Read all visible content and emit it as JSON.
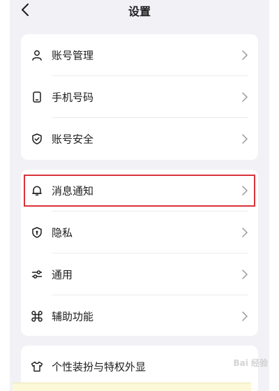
{
  "header": {
    "title": "设置"
  },
  "group1": [
    {
      "label": "账号管理",
      "icon": "user-icon"
    },
    {
      "label": "手机号码",
      "icon": "phone-icon"
    },
    {
      "label": "账号安全",
      "icon": "shield-check-icon"
    }
  ],
  "group2": [
    {
      "label": "消息通知",
      "icon": "bell-icon"
    },
    {
      "label": "隐私",
      "icon": "shield-lock-icon"
    },
    {
      "label": "通用",
      "icon": "sliders-icon"
    },
    {
      "label": "辅助功能",
      "icon": "grid-icon"
    }
  ],
  "group3": [
    {
      "label": "个性装扮与特权外显",
      "icon": "shirt-icon"
    }
  ],
  "watermark": "Bai 经验",
  "colors": {
    "highlight": "#d9323a",
    "background": "#f2f2f6",
    "card": "#ffffff"
  }
}
